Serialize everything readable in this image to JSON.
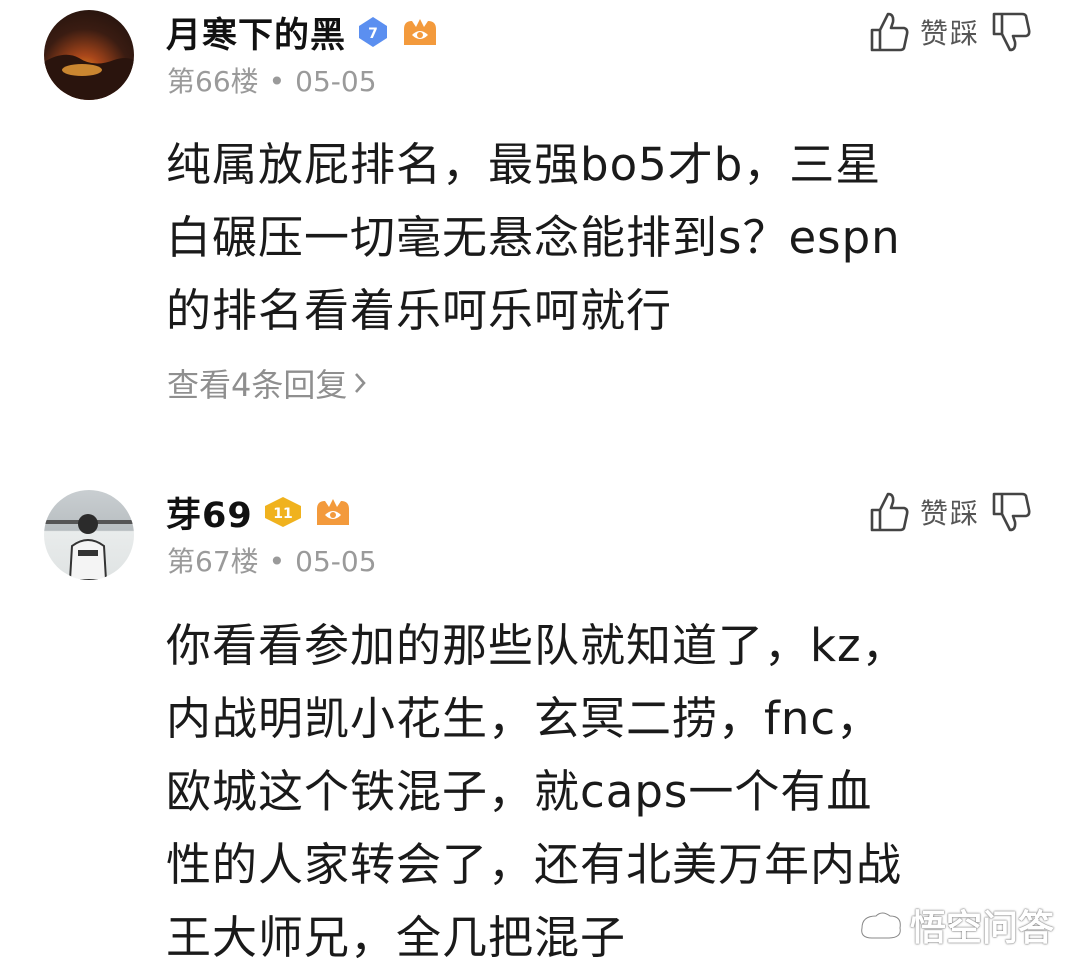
{
  "comments": [
    {
      "username": "月寒下的黑",
      "level_badge": "7",
      "floor": "第66楼",
      "date": "05-05",
      "vote_label": "赞踩",
      "content_lines": [
        "纯属放屁排名，最强bo5才b，三星",
        "白碾压一切毫无悬念能排到s？espn",
        "的排名看着乐呵乐呵就行"
      ],
      "replies_label": "查看4条回复",
      "badge_color": "#5b8ff0"
    },
    {
      "username": "芽69",
      "level_badge": "11",
      "floor": "第67楼",
      "date": "05-05",
      "vote_label": "赞踩",
      "content_lines": [
        "你看看参加的那些队就知道了，kz，",
        "内战明凯小花生，玄冥二捞，fnc，",
        "欧城这个铁混子，就caps一个有血",
        "性的人家转会了，还有北美万年内战",
        "王大师兄，全几把混子"
      ],
      "badge_color": "#f0b21e"
    }
  ],
  "dot_separator": "•",
  "watermark": "悟空问答",
  "colors": {
    "meta_gray": "#9a9a9a",
    "fan_badge": "#f39a3c"
  }
}
